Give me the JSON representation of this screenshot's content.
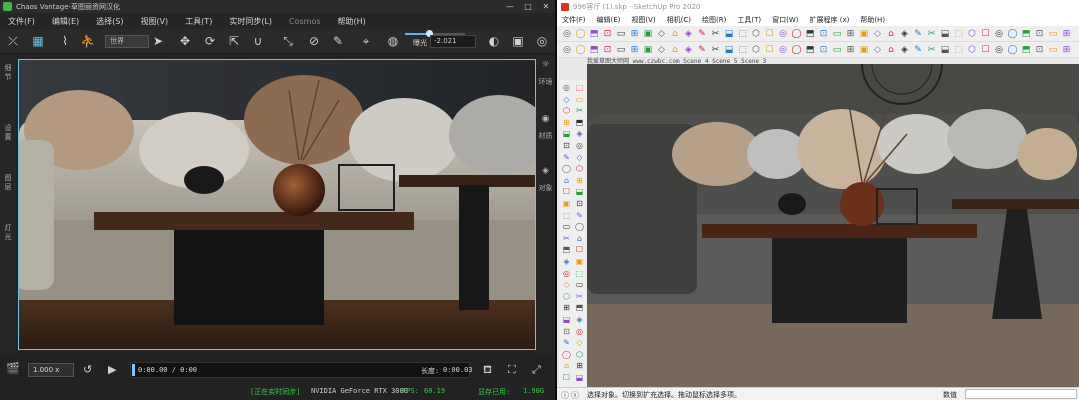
{
  "left": {
    "title": "Chaos Vantage-草图丽资网汉化",
    "window_buttons": [
      "—",
      "□",
      "✕"
    ],
    "menu": [
      "文件(F)",
      "编辑(E)",
      "选择(S)",
      "视图(V)",
      "工具(T)",
      "实时同步(L)",
      "Cosmos",
      "帮助(H)"
    ],
    "view_mode": "世界",
    "exposure_label": "曝光",
    "exposure_value": "-2.021",
    "exposure_level": 0.4,
    "side_labels": [
      "细节",
      "设置",
      "图层",
      "灯光"
    ],
    "right_labels": [
      "环境",
      "材质",
      "对象"
    ],
    "speed": "1.000 x",
    "time_current": "0:00.00 / 0:00",
    "length_label": "长度:",
    "length_value": "0:00.03",
    "status_sync": "[正在实时同步]",
    "status_gpu": "NVIDIA GeForce RTX 3080",
    "fps_label": "FPS:",
    "fps_value": "60.19",
    "vram_label": "显存已用:",
    "vram_value": "1.90G",
    "colors": {
      "accent": "#6fc3e8",
      "status_green": "#3bc94a"
    }
  },
  "right": {
    "title": "996客厅 (1).skp - SketchUp Pro 2020",
    "window_buttons": [
      "—",
      "□",
      "✕"
    ],
    "menu": [
      "文件(F)",
      "编辑(E)",
      "视图(V)",
      "相机(C)",
      "绘图(R)",
      "工具(T)",
      "窗口(W)",
      "扩展程序 (x)",
      "帮助(H)"
    ],
    "scene_tabs": "我爱草图大师网 www.czwbc.com  Scene 4  Scene 5  Scene 3",
    "status_hint": "选择对象。切换到扩充选择。拖动鼠标选择多项。",
    "measure_label": "数值"
  }
}
